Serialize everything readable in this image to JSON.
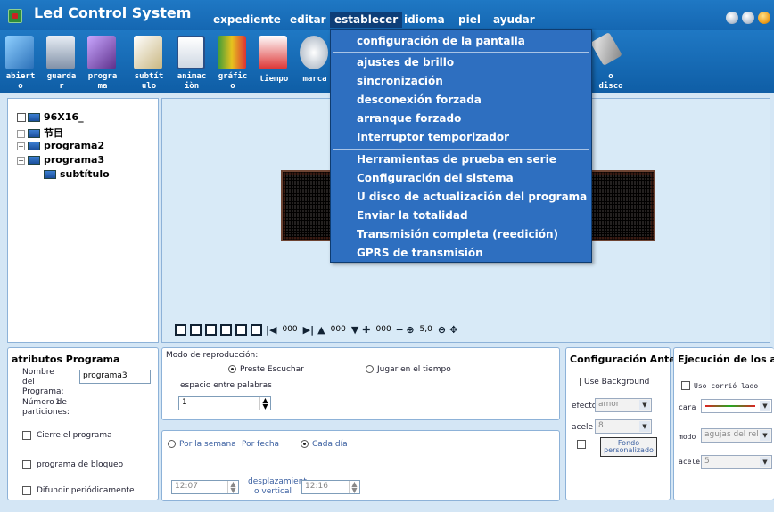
{
  "app": {
    "title": "Led Control System"
  },
  "menubar": {
    "items": [
      "expediente",
      "editar",
      "establecer",
      "idioma",
      "piel",
      "ayudar"
    ]
  },
  "toolbar": {
    "items": [
      "abiert\no",
      "guarda\nr",
      "progra\nma",
      "subtít\nulo",
      "animac\niòn",
      "gráfic\no",
      "tiempo",
      "marca",
      "",
      "",
      "",
      "",
      "",
      "",
      "",
      "o\ndisco"
    ]
  },
  "tree": {
    "root": "96X16_",
    "nodes": [
      "节目",
      "programa2",
      "programa3"
    ],
    "child": "subtítulo"
  },
  "preview_toolbar": {
    "values": [
      "000",
      "000",
      "000",
      "5,0"
    ]
  },
  "dropdown": {
    "items": [
      "configuración de la pantalla",
      "ajustes de brillo",
      "sincronización",
      "desconexión forzada",
      "arranque forzado",
      "Interruptor temporizador",
      "Herramientas de prueba en serie",
      "Configuración del sistema",
      "U disco de actualización del programa",
      "Enviar la totalidad",
      "Transmisión completa (reedición)",
      "GPRS de transmisión"
    ]
  },
  "program_attrs": {
    "title": "atributos Programa",
    "name_label": "Nombre del Programa:",
    "name_value": "programa3",
    "partitions_label": "Número de particiones:",
    "partitions_value": "1",
    "cb1": "Cierre el programa",
    "cb2": "programa de bloqueo",
    "cb3": "Difundir periódicamente"
  },
  "play_mode": {
    "label": "Modo de reproducción:",
    "opt1": "Preste Escuchar",
    "opt2": "Jugar en el tiempo",
    "spacing_label": "espacio entre palabras",
    "spacing_value": "1"
  },
  "schedule": {
    "opt_week": "Por la semana",
    "opt_date": "Por fecha",
    "opt_daily": "Cada día",
    "time_start": "12:07",
    "offset_label": "desplazamient o vertical",
    "time_end": "12:16"
  },
  "bg_config": {
    "title": "Configuración Antec",
    "use_bg": "Use Background",
    "effect_label": "efecto",
    "effect_value": "amor",
    "accel_label": "acele",
    "accel_value": "8",
    "custom_bg": "Fondo personalizado"
  },
  "exec_config": {
    "title": "Ejecución de los ajus",
    "use_side": "Uso corrió lado",
    "face_label": "cara",
    "mode_label": "modo",
    "mode_value": "agujas del rel",
    "accel_label": "acelera",
    "accel_value": "5"
  },
  "colors": {
    "titlebar": "#1567b2",
    "dropdown": "#2e6fc0",
    "led": "#3a1a12"
  }
}
